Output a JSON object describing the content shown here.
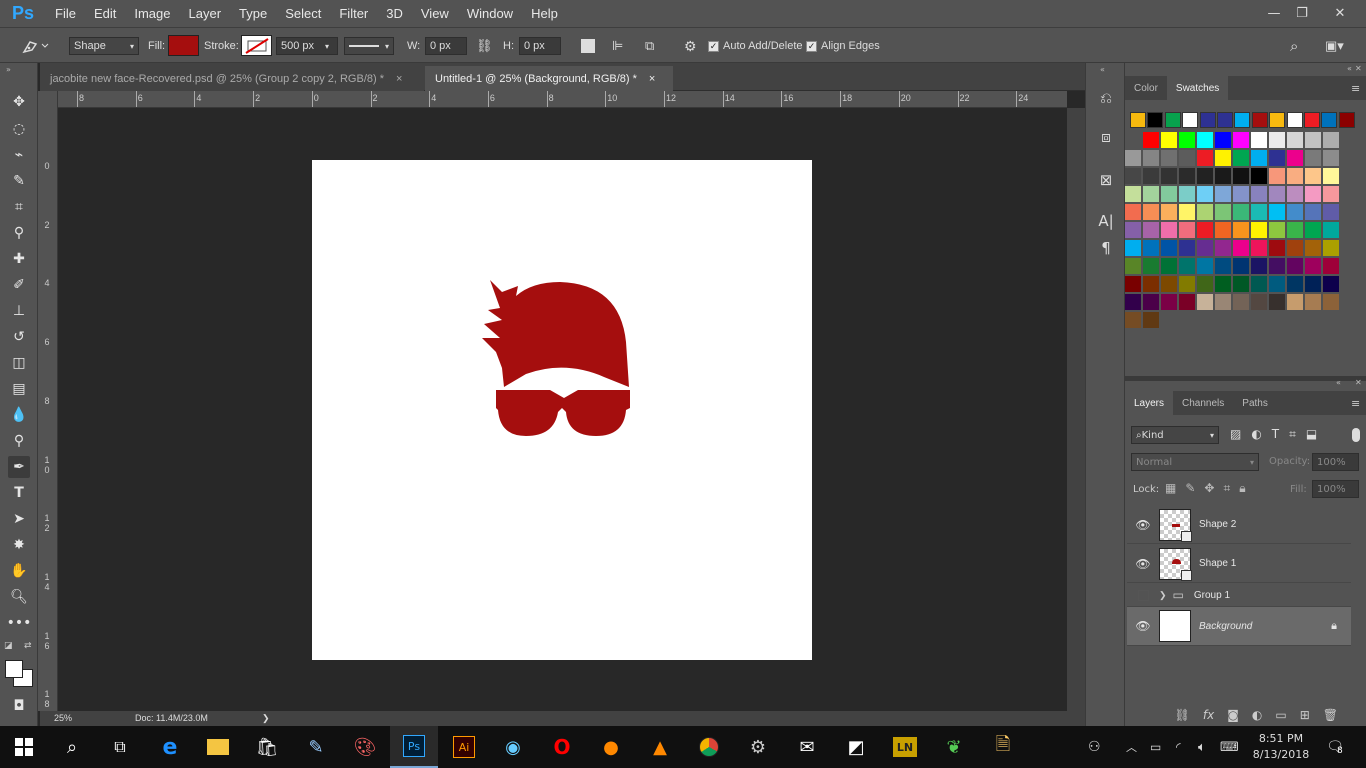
{
  "app": {
    "logo": "Ps"
  },
  "menu": [
    "File",
    "Edit",
    "Image",
    "Layer",
    "Type",
    "Select",
    "Filter",
    "3D",
    "View",
    "Window",
    "Help"
  ],
  "window_controls": {
    "minimize": "—",
    "restore": "❐",
    "close": "✕"
  },
  "options_bar": {
    "mode": "Shape",
    "fill_label": "Fill:",
    "fill_color": "#a50e0e",
    "stroke_label": "Stroke:",
    "stroke_width": "500 px",
    "w_label": "W:",
    "w_value": "0 px",
    "h_label": "H:",
    "h_value": "0 px",
    "auto_add_delete": "Auto Add/Delete",
    "align_edges": "Align Edges"
  },
  "tabs": [
    {
      "label": "jacobite new face-Recovered.psd @ 25% (Group 2 copy 2, RGB/8) *",
      "close": "×",
      "active": false
    },
    {
      "label": "Untitled-1 @ 25% (Background, RGB/8) *",
      "close": "×",
      "active": true
    }
  ],
  "ruler_h": [
    "8",
    "6",
    "4",
    "2",
    "0",
    "2",
    "4",
    "6",
    "8",
    "10",
    "12",
    "14",
    "16",
    "18",
    "20",
    "22",
    "24"
  ],
  "ruler_v": [
    "0",
    "2",
    "4",
    "6",
    "8",
    "1\n0",
    "1\n2",
    "1\n4",
    "1\n6",
    "1\n8"
  ],
  "artwork": {
    "color": "#a50e0e"
  },
  "status": {
    "zoom": "25%",
    "doc": "Doc: 11.4M/23.0M",
    "arrow": "❯"
  },
  "color_panel": {
    "tabs": [
      "Color",
      "Swatches"
    ],
    "recent": [
      "#f7b90f",
      "#000000",
      "#07a14d",
      "#ffffff",
      "#2e3192",
      "#2e3192",
      "#00aeef",
      "#a50e0e",
      "#f7b90f",
      "#ffffff",
      "#ed1c24",
      "#0072bc",
      "#8b0000"
    ],
    "swatches": [
      [
        "#ff0000",
        "#ffff00",
        "#00ff00",
        "#00ffff",
        "#0000ff",
        "#ff00ff",
        "#ffffff",
        "#ebebeb",
        "#d6d6d6",
        "#c2c2c2",
        "#adadad"
      ],
      [
        "#999999",
        "#858585",
        "#707070",
        "#5c5c5c",
        "#ed1c24",
        "#fff200",
        "#00a651",
        "#00aeef",
        "#2e3192",
        "#ec008c",
        "#7a7a7a",
        "#8c8c8c"
      ],
      [
        "#474747",
        "#3b3b3b",
        "#333333",
        "#2b2b2b",
        "#222222",
        "#1a1a1a",
        "#111111",
        "#000000",
        "#f7977a",
        "#f9ad81",
        "#fdc68a",
        "#fff79a"
      ],
      [
        "#c4df9b",
        "#a3d39c",
        "#82ca9d",
        "#7bcdc8",
        "#6ecff6",
        "#7ea7d8",
        "#8493ca",
        "#8882be",
        "#a187be",
        "#bc8dbf",
        "#f49ac2",
        "#f6989d"
      ],
      [
        "#f26c4f",
        "#f68e55",
        "#fbaf5c",
        "#fff467",
        "#acd372",
        "#7cc576",
        "#3bb878",
        "#1abbb4",
        "#00bff3",
        "#438ccb",
        "#5574b9",
        "#605ca8"
      ],
      [
        "#8560a8",
        "#a763a8",
        "#f06eaa",
        "#f26d7d",
        "#ed1c24",
        "#f26522",
        "#f7941d",
        "#fff200",
        "#8dc73f",
        "#39b54a",
        "#00a651",
        "#00a99d"
      ],
      [
        "#00aeef",
        "#0072bc",
        "#0054a6",
        "#2e3192",
        "#662d91",
        "#92278f",
        "#ec008c",
        "#ed145b",
        "#9e0b0f",
        "#a0410d",
        "#a36209",
        "#aba000"
      ],
      [
        "#598527",
        "#197b30",
        "#007236",
        "#00746b",
        "#0076a3",
        "#004b80",
        "#003471",
        "#1b1464",
        "#440e62",
        "#630460",
        "#9e005d",
        "#9e0039"
      ],
      [
        "#790000",
        "#7b2e00",
        "#7d4900",
        "#827b00",
        "#406618",
        "#005e20",
        "#005826",
        "#005952",
        "#005b7f",
        "#003663",
        "#002157",
        "#0d004c"
      ],
      [
        "#32004b",
        "#4b0049",
        "#7b0046",
        "#7a0026",
        "#c7b299",
        "#998675",
        "#736357",
        "#534741",
        "#37302d",
        "#c69c6d",
        "#a67c52",
        "#8c6239"
      ],
      [
        "#754c24",
        "#603913"
      ]
    ]
  },
  "layers_panel": {
    "tabs": [
      "Layers",
      "Channels",
      "Paths"
    ],
    "filter": "Kind",
    "blend_mode": "Normal",
    "opacity_label": "Opacity:",
    "opacity_value": "100%",
    "lock_label": "Lock:",
    "fill_label": "Fill:",
    "fill_value": "100%",
    "layers": [
      {
        "name": "Shape 2",
        "visible": true
      },
      {
        "name": "Shape 1",
        "visible": true
      },
      {
        "name": "Group 1",
        "visible": false
      },
      {
        "name": "Background",
        "visible": true,
        "selected": true,
        "locked": true
      }
    ]
  },
  "taskbar": {
    "time": "8:51 PM",
    "date": "8/13/2018",
    "notifications": "8"
  }
}
